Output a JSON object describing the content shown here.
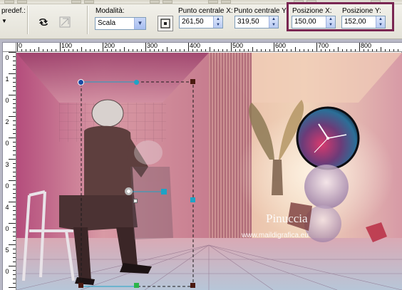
{
  "toolbar": {
    "preset_label": "predef.:",
    "mode_label": "Modalità:",
    "mode_value": "Scala",
    "center_x_label": "Punto centrale X:",
    "center_x_value": "261,50",
    "center_y_label": "Punto centrale Y:",
    "center_y_value": "319,50",
    "pos_x_label": "Posizione X:",
    "pos_x_value": "150,00",
    "pos_y_label": "Posizione Y:",
    "pos_y_value": "152,00",
    "highlight_color": "#7a2652"
  },
  "ruler": {
    "top_labels": [
      "0",
      "100",
      "200",
      "300",
      "400",
      "500",
      "600",
      "700",
      "800"
    ],
    "left_labels": [
      "0",
      "1",
      "0",
      "2",
      "0",
      "3",
      "0",
      "4",
      "0",
      "5",
      "0"
    ]
  },
  "canvas": {
    "watermark_title": "Pinuccia",
    "watermark_url": "www.maildigrafica.eu"
  },
  "colors": {
    "accent": "#7a2652",
    "handle_cyan": "#1ea3c6",
    "handle_dark": "#4a1a10",
    "handle_green": "#2bb54a"
  }
}
